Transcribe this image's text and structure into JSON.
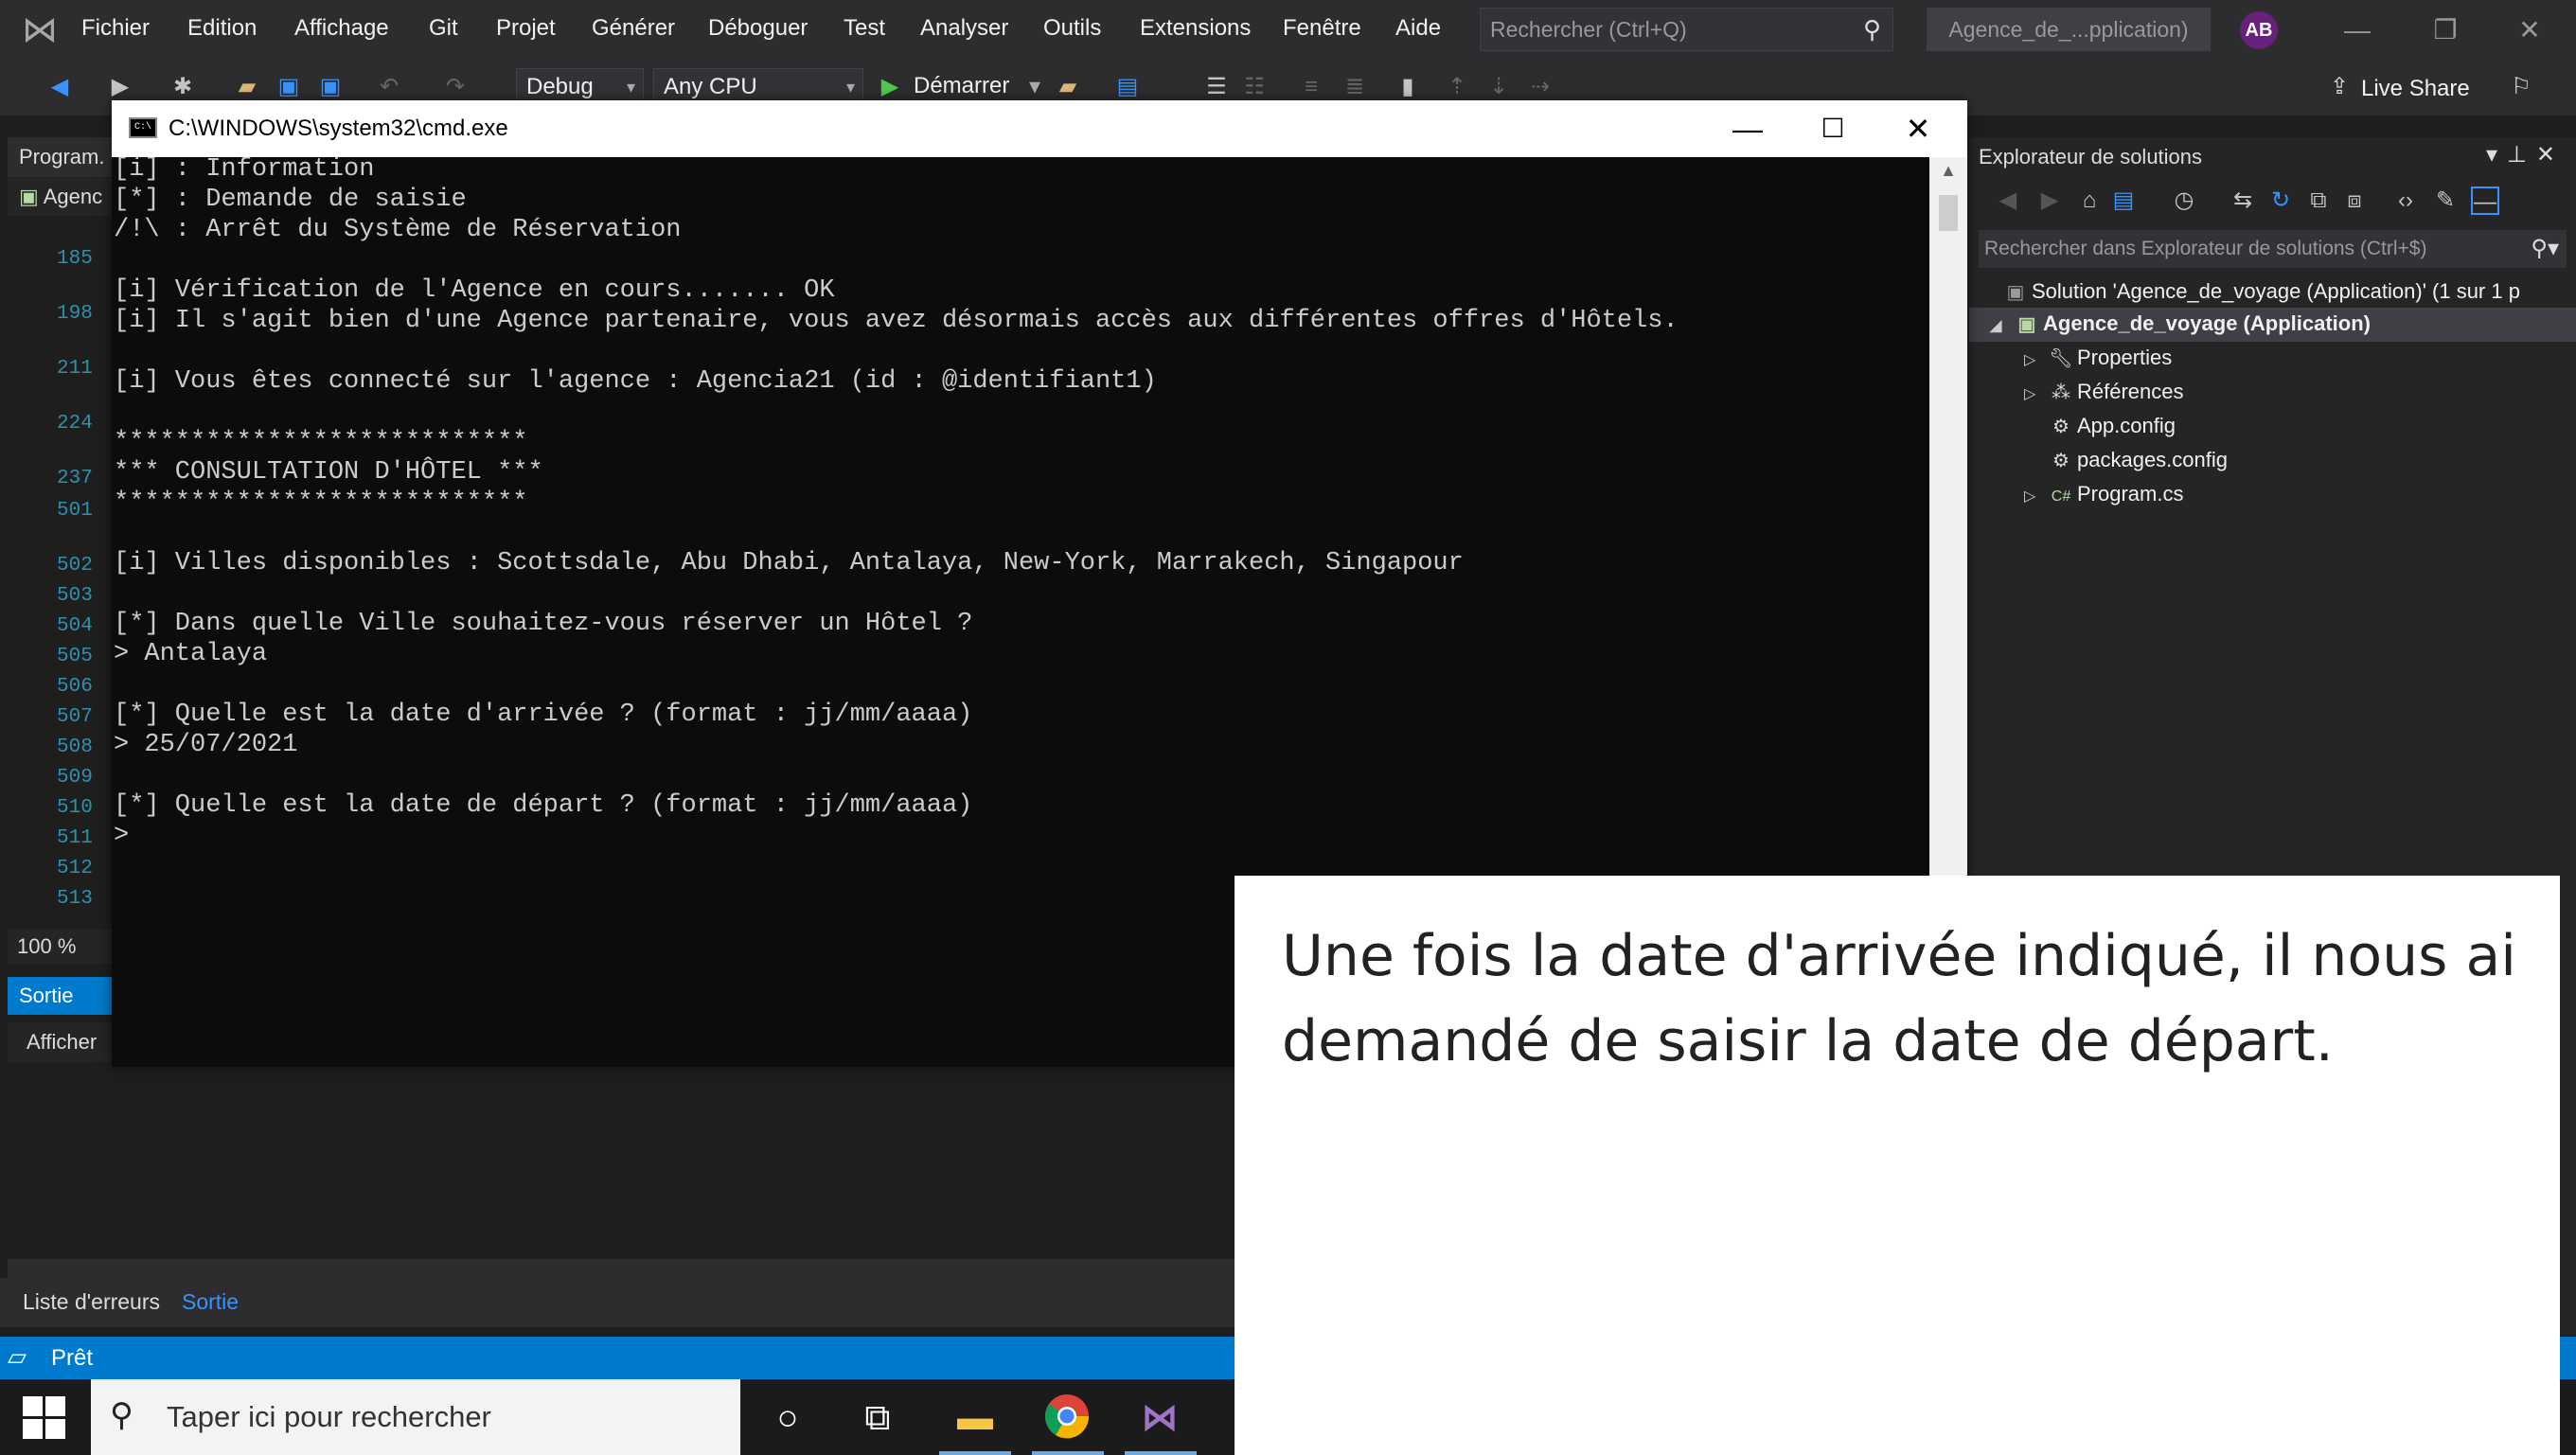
{
  "vs": {
    "menu": [
      "Fichier",
      "Edition",
      "Affichage",
      "Git",
      "Projet",
      "Générer",
      "Déboguer",
      "Test",
      "Analyser",
      "Outils",
      "Extensions",
      "Fenêtre",
      "Aide"
    ],
    "search_placeholder": "Rechercher (Ctrl+Q)",
    "project_name": "Agence_de_...pplication)",
    "avatar_initials": "AB",
    "toolbar": {
      "config": "Debug",
      "platform": "Any CPU",
      "start_label": "Démarrer",
      "live_share": "Live Share"
    },
    "editor_tab": "Program.",
    "nav_dropdown": "Agenc",
    "line_numbers": [
      "185",
      "198",
      "211",
      "224",
      "237",
      "501",
      "502",
      "503",
      "504",
      "505",
      "506",
      "507",
      "508",
      "509",
      "510",
      "511",
      "512",
      "513"
    ],
    "zoom": "100 %",
    "output_tab": "Sortie",
    "afficher_label": "Afficher",
    "bottom_tabs": [
      "Liste d'erreurs",
      "Sortie"
    ],
    "status": "Prêt"
  },
  "solution_explorer": {
    "title": "Explorateur de solutions",
    "search_placeholder": "Rechercher dans Explorateur de solutions (Ctrl+$)",
    "solution": "Solution 'Agence_de_voyage (Application)' (1 sur 1 p",
    "project": "Agence_de_voyage (Application)",
    "items": [
      "Properties",
      "Références",
      "App.config",
      "packages.config",
      "Program.cs"
    ]
  },
  "cmd": {
    "title": "C:\\WINDOWS\\system32\\cmd.exe",
    "lines": [
      "[i] : Information",
      "[*] : Demande de saisie",
      "/!\\ : Arrêt du Système de Réservation",
      "",
      "[i] Vérification de l'Agence en cours....... OK",
      "[i] Il s'agit bien d'une Agence partenaire, vous avez désormais accès aux différentes offres d'Hôtels.",
      "",
      "[i] Vous êtes connecté sur l'agence : Agencia21 (id : @identifiant1)",
      "",
      "***************************",
      "*** CONSULTATION D'HÔTEL ***",
      "***************************",
      "",
      "[i] Villes disponibles : Scottsdale, Abu Dhabi, Antalaya, New-York, Marrakech, Singapour",
      "",
      "[*] Dans quelle Ville souhaitez-vous réserver un Hôtel ?",
      "> Antalaya",
      "",
      "[*] Quelle est la date d'arrivée ? (format : jj/mm/aaaa)",
      "> 25/07/2021",
      "",
      "[*] Quelle est la date de départ ? (format : jj/mm/aaaa)",
      ">"
    ]
  },
  "taskbar": {
    "search_placeholder": "Taper ici pour rechercher"
  },
  "caption": "Une fois la date d'arrivée indiqué, il nous ai demandé de saisir la date de départ."
}
